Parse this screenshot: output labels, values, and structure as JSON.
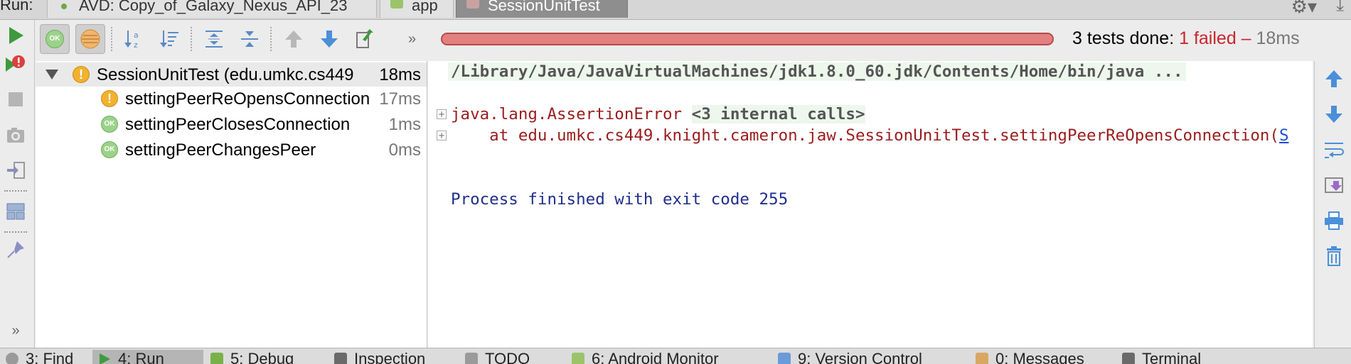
{
  "top_bar": {
    "run_label": "Run:",
    "tabs": [
      {
        "label": "AVD: Copy_of_Galaxy_Nexus_API_23",
        "icon": "device-icon"
      },
      {
        "label": "app",
        "icon": "android-icon"
      },
      {
        "label": "SessionUnitTest",
        "icon": "test-icon",
        "active": true
      }
    ]
  },
  "toolbar": {
    "more_label": "»",
    "summary_prefix": "3 tests done: ",
    "summary_failed": "1 failed",
    "summary_sep": " – ",
    "summary_time": "18ms",
    "progress_fraction": 1.0
  },
  "tree": {
    "root": {
      "label": "SessionUnitTest (edu.umkc.cs449",
      "duration": "18ms",
      "status": "warning"
    },
    "children": [
      {
        "label": "settingPeerReOpensConnection",
        "duration": "17ms",
        "status": "warning"
      },
      {
        "label": "settingPeerClosesConnection",
        "duration": "1ms",
        "status": "ok"
      },
      {
        "label": "settingPeerChangesPeer",
        "duration": "0ms",
        "status": "ok"
      }
    ]
  },
  "badges": {
    "ok": "OK",
    "warn": "!"
  },
  "console": {
    "command": "/Library/Java/JavaVirtualMachines/jdk1.8.0_60.jdk/Contents/Home/bin/java ...",
    "error": "java.lang.AssertionError",
    "internal_calls": "<3 internal calls>",
    "stack_prefix": "    at edu.umkc.cs449.knight.cameron.jaw.SessionUnitTest.settingPeerReOpensConnection(",
    "stack_link": "S",
    "exit_message": "Process finished with exit code 255"
  },
  "left_toolbar": {
    "more_label": "»"
  },
  "bottom_bar": {
    "tabs": [
      {
        "label": "3: Find",
        "icon": "find-icon"
      },
      {
        "label": "4: Run",
        "icon": "run-icon",
        "active": true
      },
      {
        "label": "5: Debug",
        "icon": "debug-icon"
      },
      {
        "label": "Inspection",
        "icon": "inspection-icon"
      },
      {
        "label": "TODO",
        "icon": "todo-icon"
      },
      {
        "label": "6: Android Monitor",
        "icon": "android-icon"
      },
      {
        "label": "9: Version Control",
        "icon": "vcs-icon"
      },
      {
        "label": "0: Messages",
        "icon": "messages-icon"
      },
      {
        "label": "Terminal",
        "icon": "terminal-icon"
      }
    ]
  },
  "colors": {
    "failed": "#c8262c",
    "error_text": "#9b1c1c",
    "exit_text": "#1f2e8c",
    "progress_fail": "#d86a6a",
    "ok_green": "#9bd28a",
    "warn_orange": "#f2b12f"
  }
}
